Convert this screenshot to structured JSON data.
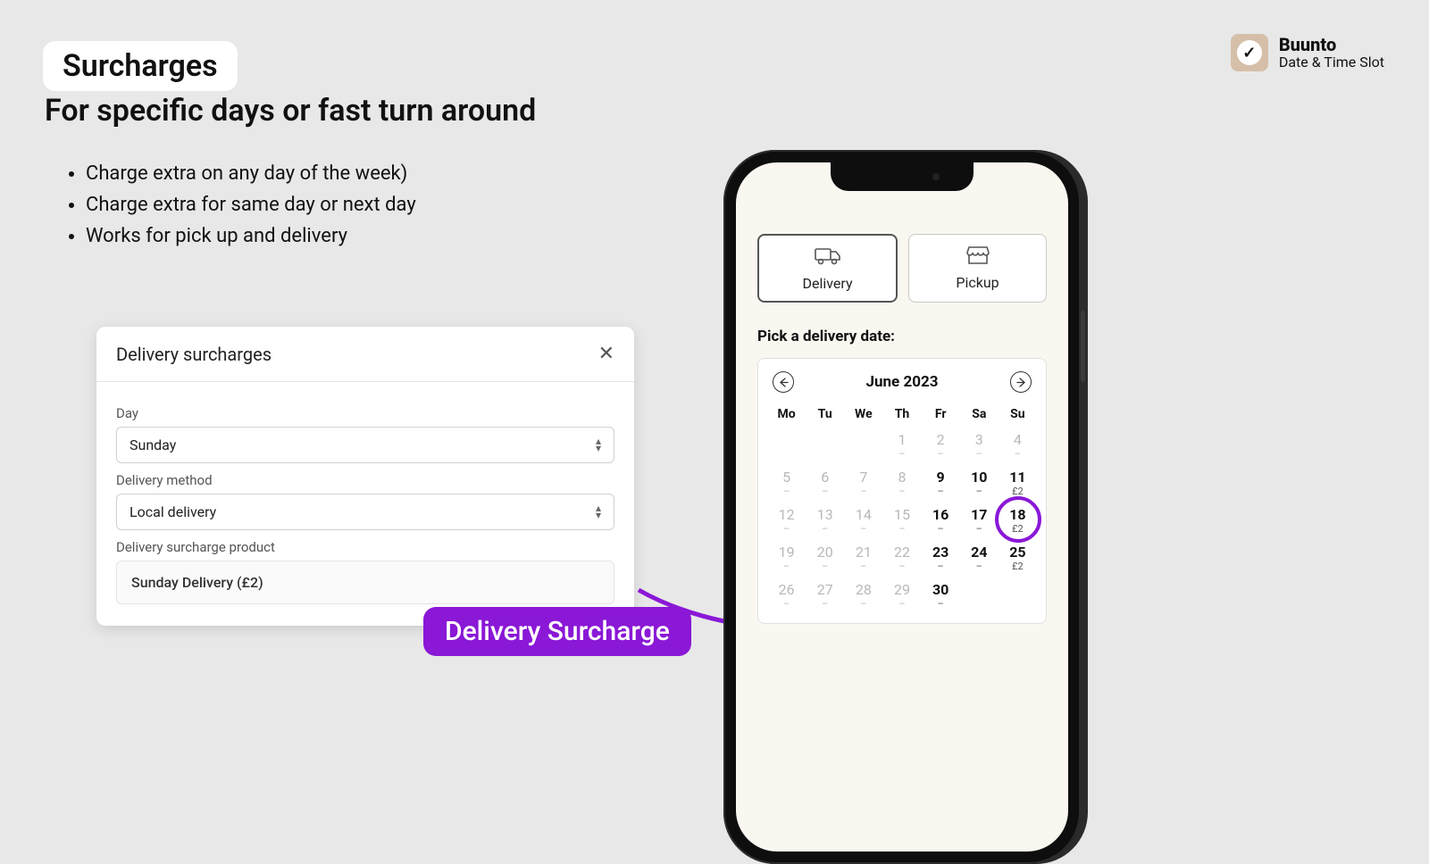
{
  "header": {
    "title": "Surcharges",
    "subtitle": "For specific days or fast turn around",
    "bullets": [
      "Charge extra on any day of the week)",
      "Charge extra for same day or next day",
      "Works for pick up and delivery"
    ]
  },
  "brand": {
    "name": "Buunto",
    "tagline": "Date & Time Slot"
  },
  "modal": {
    "title": "Delivery surcharges",
    "fields": {
      "day_label": "Day",
      "day_value": "Sunday",
      "method_label": "Delivery method",
      "method_value": "Local delivery",
      "product_label": "Delivery surcharge product",
      "product_value": "Sunday Delivery (£2)"
    }
  },
  "callout": {
    "label": "Delivery Surcharge"
  },
  "phone": {
    "tabs": {
      "delivery": "Delivery",
      "pickup": "Pickup"
    },
    "pick_label": "Pick a delivery date:",
    "calendar": {
      "month": "June 2023",
      "dow": [
        "Mo",
        "Tu",
        "We",
        "Th",
        "Fr",
        "Sa",
        "Su"
      ],
      "cells": [
        {
          "empty": true
        },
        {
          "empty": true
        },
        {
          "empty": true
        },
        {
          "day": "1",
          "sub": "–",
          "disabled": true
        },
        {
          "day": "2",
          "sub": "–",
          "disabled": true
        },
        {
          "day": "3",
          "sub": "–",
          "disabled": true
        },
        {
          "day": "4",
          "sub": "–",
          "disabled": true
        },
        {
          "day": "5",
          "sub": "–",
          "disabled": true
        },
        {
          "day": "6",
          "sub": "–",
          "disabled": true
        },
        {
          "day": "7",
          "sub": "–",
          "disabled": true
        },
        {
          "day": "8",
          "sub": "–",
          "disabled": true
        },
        {
          "day": "9",
          "sub": "–",
          "disabled": false
        },
        {
          "day": "10",
          "sub": "–",
          "disabled": false
        },
        {
          "day": "11",
          "sub": "£2",
          "disabled": false
        },
        {
          "day": "12",
          "sub": "–",
          "disabled": true
        },
        {
          "day": "13",
          "sub": "–",
          "disabled": true
        },
        {
          "day": "14",
          "sub": "–",
          "disabled": true
        },
        {
          "day": "15",
          "sub": "–",
          "disabled": true
        },
        {
          "day": "16",
          "sub": "–",
          "disabled": false
        },
        {
          "day": "17",
          "sub": "–",
          "disabled": false
        },
        {
          "day": "18",
          "sub": "£2",
          "disabled": false,
          "highlight": true
        },
        {
          "day": "19",
          "sub": "–",
          "disabled": true
        },
        {
          "day": "20",
          "sub": "–",
          "disabled": true
        },
        {
          "day": "21",
          "sub": "–",
          "disabled": true
        },
        {
          "day": "22",
          "sub": "–",
          "disabled": true
        },
        {
          "day": "23",
          "sub": "–",
          "disabled": false
        },
        {
          "day": "24",
          "sub": "–",
          "disabled": false
        },
        {
          "day": "25",
          "sub": "£2",
          "disabled": false
        },
        {
          "day": "26",
          "sub": "–",
          "disabled": true
        },
        {
          "day": "27",
          "sub": "–",
          "disabled": true
        },
        {
          "day": "28",
          "sub": "–",
          "disabled": true
        },
        {
          "day": "29",
          "sub": "–",
          "disabled": true
        },
        {
          "day": "30",
          "sub": "–",
          "disabled": false
        },
        {
          "empty": true
        },
        {
          "empty": true
        }
      ]
    }
  },
  "colors": {
    "accent": "#8a18d6"
  }
}
